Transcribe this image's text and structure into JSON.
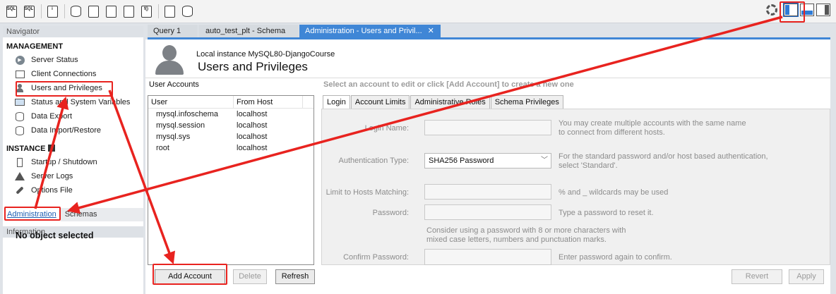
{
  "navigator": {
    "title": "Navigator",
    "management": {
      "title": "MANAGEMENT",
      "items": [
        {
          "label": "Server Status",
          "icon": "server-status-icon"
        },
        {
          "label": "Client Connections",
          "icon": "client-connections-icon"
        },
        {
          "label": "Users and Privileges",
          "icon": "user-icon"
        },
        {
          "label": "Status and System Variables",
          "icon": "monitor-icon"
        },
        {
          "label": "Data Export",
          "icon": "data-export-icon"
        },
        {
          "label": "Data Import/Restore",
          "icon": "data-import-icon"
        }
      ]
    },
    "instance": {
      "title": "INSTANCE",
      "items": [
        {
          "label": "Startup / Shutdown",
          "icon": "startup-icon"
        },
        {
          "label": "Server Logs",
          "icon": "warning-icon"
        },
        {
          "label": "Options File",
          "icon": "wrench-icon"
        }
      ]
    },
    "tabs": {
      "administration": "Administration",
      "schemas": "Schemas"
    },
    "information": {
      "title": "Information",
      "empty": "No object selected"
    }
  },
  "document_tabs": [
    {
      "label": "Query 1"
    },
    {
      "label": "auto_test_plt - Schema"
    },
    {
      "label": "Administration - Users and Privil...",
      "close": "✕"
    }
  ],
  "header": {
    "connection": "Local instance MySQL80-DjangoCourse",
    "title": "Users and Privileges"
  },
  "accounts": {
    "label": "User Accounts",
    "columns": [
      "User",
      "From Host"
    ],
    "rows": [
      {
        "user": "mysql.infoschema",
        "host": "localhost"
      },
      {
        "user": "mysql.session",
        "host": "localhost"
      },
      {
        "user": "mysql.sys",
        "host": "localhost"
      },
      {
        "user": "root",
        "host": "localhost"
      }
    ],
    "buttons": {
      "add": "Add Account",
      "delete": "Delete",
      "refresh": "Refresh"
    }
  },
  "details": {
    "hint": "Select an account to edit or click [Add Account] to create a new one",
    "tabs": [
      "Login",
      "Account Limits",
      "Administrative Roles",
      "Schema Privileges"
    ],
    "fields": {
      "login_name": {
        "label": "Login Name:",
        "help1": "You may create multiple accounts with the same name",
        "help2": "to connect from different hosts."
      },
      "auth_type": {
        "label": "Authentication Type:",
        "value": "SHA256 Password",
        "help1": "For the standard password and/or host based authentication,",
        "help2": "select 'Standard'."
      },
      "hosts": {
        "label": "Limit to Hosts Matching:",
        "help1": "% and _ wildcards may be used"
      },
      "password": {
        "label": "Password:",
        "help1": "Type a password to reset it."
      },
      "password_hint": {
        "line1": "Consider using a password with 8 or more characters with",
        "line2": "mixed case letters, numbers and punctuation marks."
      },
      "confirm": {
        "label": "Confirm Password:",
        "help1": "Enter password again to confirm."
      }
    },
    "buttons": {
      "revert": "Revert",
      "apply": "Apply"
    }
  },
  "colors": {
    "accent": "#3f86d6",
    "annotation": "#e8231f"
  }
}
